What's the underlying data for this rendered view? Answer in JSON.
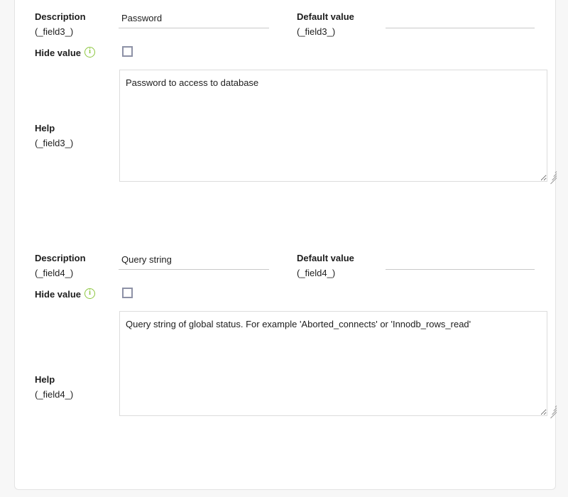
{
  "form": {
    "fields": [
      {
        "key": "_field3_",
        "description_label": "Description",
        "description_sub": "(_field3_)",
        "description_value": "Password",
        "description_placeholder": "",
        "default_label": "Default value",
        "default_sub": "(_field3_)",
        "default_value": "",
        "default_placeholder": "",
        "hide_value_label": "Hide value",
        "hide_value_info": "i",
        "hide_value_checked": false,
        "help_label": "Help",
        "help_sub": "(_field3_)",
        "help_value": "Password to access to database",
        "help_placeholder": ""
      },
      {
        "key": "_field4_",
        "description_label": "Description",
        "description_sub": "(_field4_)",
        "description_value": "Query string",
        "description_placeholder": "",
        "default_label": "Default value",
        "default_sub": "(_field4_)",
        "default_value": "",
        "default_placeholder": "",
        "hide_value_label": "Hide value",
        "hide_value_info": "i",
        "hide_value_checked": false,
        "help_label": "Help",
        "help_sub": "(_field4_)",
        "help_value": "Query string of global status. For example 'Aborted_connects' or 'Innodb_rows_read'",
        "help_placeholder": ""
      }
    ]
  },
  "colors": {
    "page_background": "#f7f7f7",
    "card_background": "#ffffff",
    "card_border": "#e4e4e4",
    "info_icon_green": "#8cc63f",
    "checkbox_border": "#8d91a6",
    "input_underline": "#c9c9c9",
    "textarea_border": "#dcdcdc",
    "text": "#1d1d1d"
  }
}
